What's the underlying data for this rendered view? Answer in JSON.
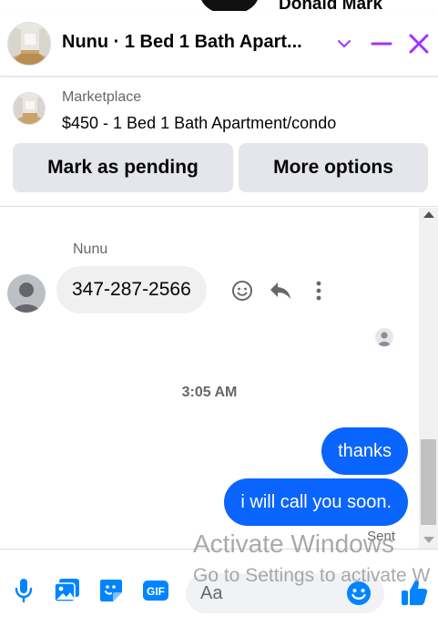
{
  "background": {
    "name": "Donald Mark"
  },
  "header": {
    "title": "Nunu · 1 Bed 1 Bath Apart...",
    "accent_color": "#a033ff"
  },
  "marketplace": {
    "label": "Marketplace",
    "listing": "$450 - 1 Bed 1 Bath Apartment/condo",
    "pending_button": "Mark as pending",
    "options_button": "More options"
  },
  "conversation": {
    "sender_name": "Nunu",
    "incoming_message": "347-287-2566",
    "timestamp": "3:05 AM",
    "outgoing_messages": [
      "thanks",
      "i will call you soon."
    ],
    "status": "Sent",
    "outgoing_color": "#0a64fe"
  },
  "composer": {
    "placeholder": "Aa",
    "gif_label": "GIF",
    "icons": [
      "microphone-icon",
      "image-icon",
      "sticker-icon",
      "gif-icon",
      "emoji-icon",
      "thumbs-up-icon"
    ],
    "accent_color": "#0084ff"
  },
  "watermark": {
    "line1": "Activate Windows",
    "line2": "Go to Settings to activate W"
  }
}
